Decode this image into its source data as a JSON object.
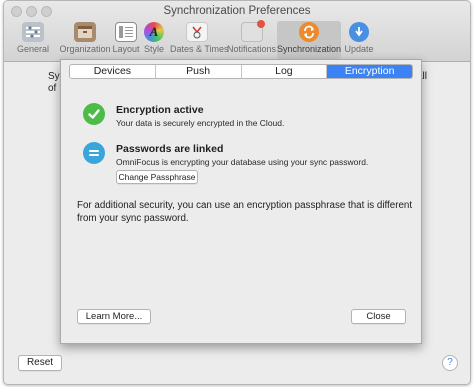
{
  "window": {
    "title": "Synchronization Preferences"
  },
  "toolbar": {
    "items": [
      {
        "label": "General"
      },
      {
        "label": "Organization"
      },
      {
        "label": "Layout"
      },
      {
        "label": "Style"
      },
      {
        "label": "Dates & Times"
      },
      {
        "label": "Notifications"
      },
      {
        "label": "Synchronization"
      },
      {
        "label": "Update"
      }
    ],
    "selected": "Synchronization"
  },
  "background": {
    "left_text_1": "Sy",
    "left_text_2": "of",
    "right_text": "all",
    "reset_label": "Reset",
    "help_symbol": "?"
  },
  "sheet": {
    "tabs": [
      {
        "label": "Devices"
      },
      {
        "label": "Push"
      },
      {
        "label": "Log"
      },
      {
        "label": "Encryption"
      }
    ],
    "selected_tab": "Encryption",
    "status": {
      "title": "Encryption active",
      "subtitle": "Your data is securely encrypted in the Cloud.",
      "icon": "checkmark-icon",
      "color": "#4cbb47"
    },
    "passwords": {
      "title": "Passwords are linked",
      "subtitle": "OmniFocus is encrypting your database using your sync password.",
      "icon": "equals-icon",
      "color": "#3aa5d8",
      "button_label": "Change Passphrase"
    },
    "info": "For additional security, you can use an encryption passphrase that is different from your sync password.",
    "learn_more_label": "Learn More...",
    "close_label": "Close"
  }
}
